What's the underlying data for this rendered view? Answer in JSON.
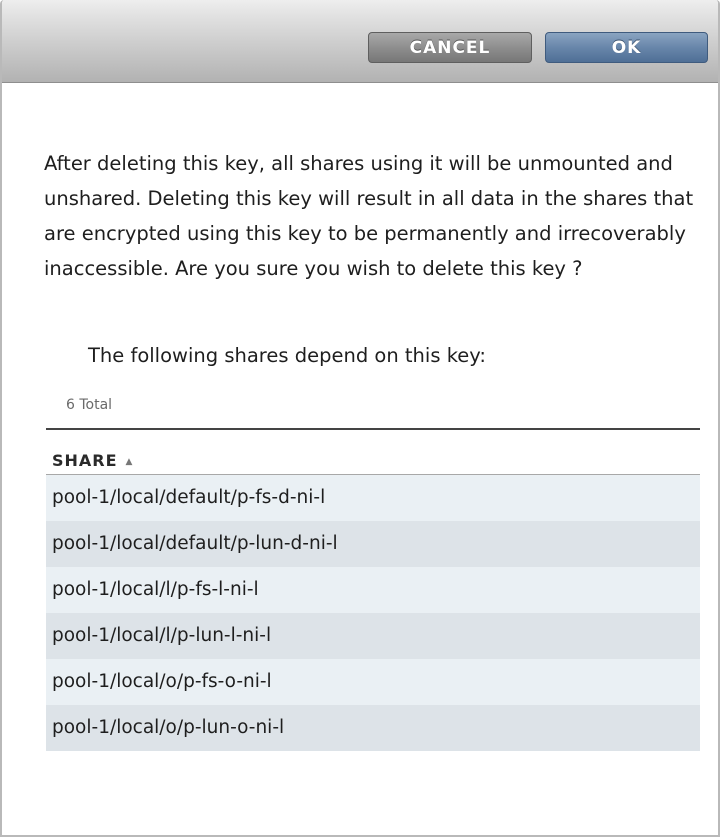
{
  "dialog": {
    "buttons": {
      "cancel_label": "CANCEL",
      "ok_label": "OK"
    },
    "message": "After deleting this key, all shares using it will be unmounted and unshared. Deleting this key will result in all data in the shares that are encrypted using this key to be permanently and irrecoverably inaccessible. Are you sure you wish to delete this key ?",
    "depends_label": "The following shares depend on this key:",
    "total_label": "6 Total",
    "table": {
      "column_header": "SHARE",
      "sort_indicator": "▲",
      "rows": [
        "pool-1/local/default/p-fs-d-ni-l",
        "pool-1/local/default/p-lun-d-ni-l",
        "pool-1/local/l/p-fs-l-ni-l",
        "pool-1/local/l/p-lun-l-ni-l",
        "pool-1/local/o/p-fs-o-ni-l",
        "pool-1/local/o/p-lun-o-ni-l"
      ]
    }
  },
  "colors": {
    "cancel_button": "#8e8e8e",
    "ok_button": "#6886aa",
    "row_odd": "#eaf0f4",
    "row_even": "#dde3e8"
  }
}
